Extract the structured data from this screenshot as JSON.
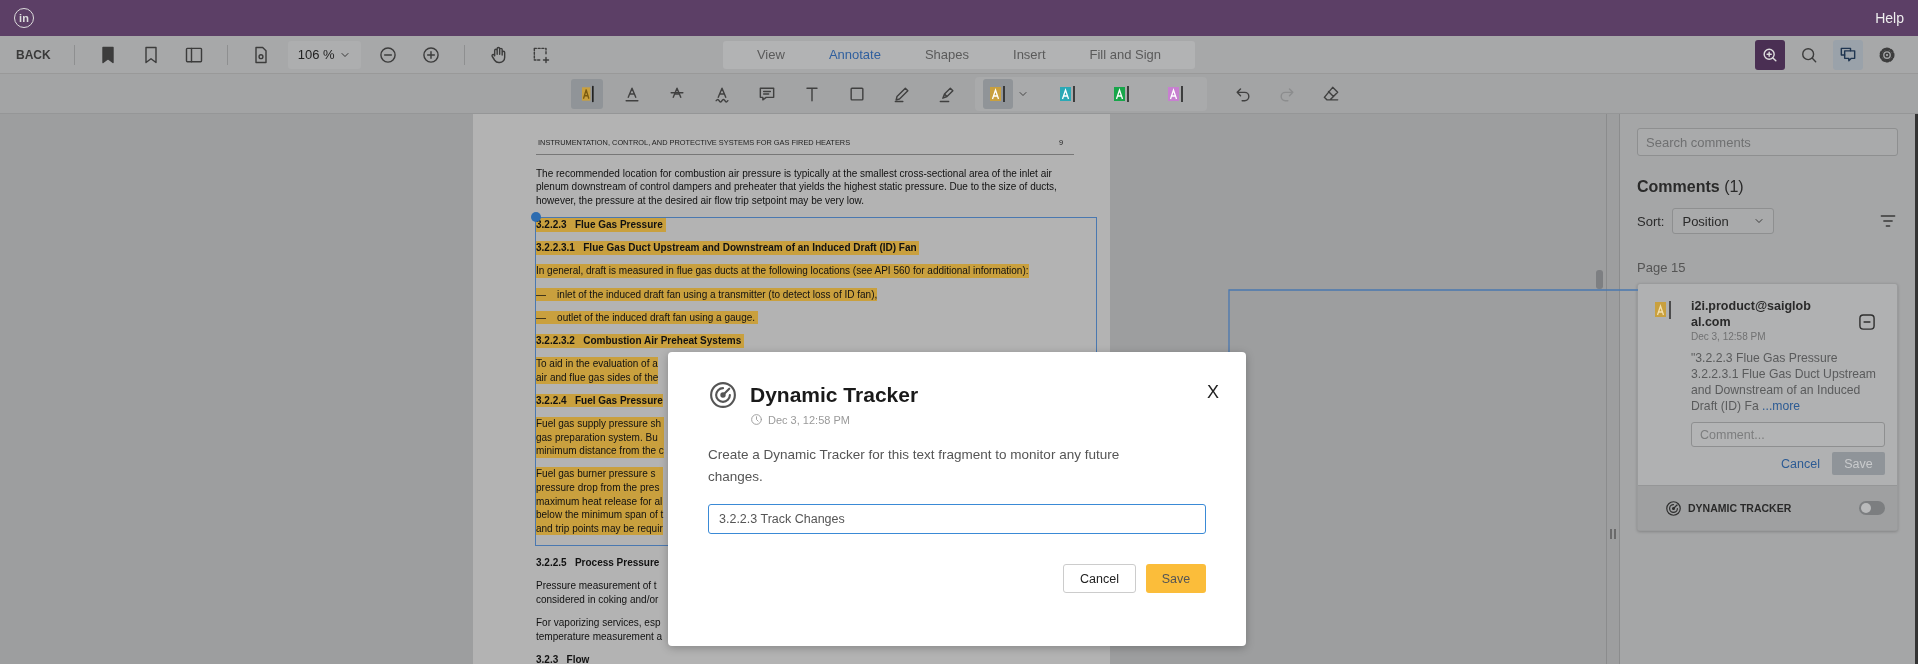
{
  "app_bar": {
    "logo_text": "in",
    "help": "Help"
  },
  "toolbar": {
    "back": "BACK",
    "zoom": "106 %",
    "mode_tabs": [
      {
        "label": "View",
        "selected": false
      },
      {
        "label": "Annotate",
        "selected": true
      },
      {
        "label": "Shapes",
        "selected": false
      },
      {
        "label": "Insert",
        "selected": false
      },
      {
        "label": "Fill and Sign",
        "selected": false
      }
    ],
    "right_tools": [
      {
        "selected": false
      },
      {
        "selected": false
      },
      {
        "selected": true
      },
      {
        "selected": false
      }
    ]
  },
  "annotation_tools": [
    {
      "selected": true
    },
    {
      "selected": false
    },
    {
      "selected": false
    },
    {
      "selected": false
    },
    {
      "selected": false
    },
    {
      "selected": false
    },
    {
      "selected": false
    },
    {
      "selected": false
    },
    {
      "selected": false
    }
  ],
  "color_tools": [
    {
      "color": "#c9a03e",
      "selected": true
    },
    {
      "color": "#2aa9b6",
      "selected": false
    },
    {
      "color": "#17a64a",
      "selected": false
    },
    {
      "color": "#c77fd0",
      "selected": false
    }
  ],
  "history_tools": [
    {
      "disabled": false
    },
    {
      "disabled": true
    }
  ],
  "document": {
    "running_header": "INSTRUMENTATION, CONTROL, AND PROTECTIVE SYSTEMS FOR GAS FIRED HEATERS",
    "page_number": "9",
    "intro": {
      "kind": "text",
      "highlighted": false,
      "lines": [
        "The recommended location for combustion air pressure is typically at the smallest cross-sectional area of the inlet air",
        "plenum downstream of control dampers and preheater that yields the highest static pressure. Due to the size of ducts,",
        "however, the pressure at the desired air flow trip setpoint may be very low."
      ]
    },
    "selection": [
      {
        "kind": "heading",
        "highlighted": true,
        "lines": [
          "3.2.2.3   Flue Gas Pressure "
        ]
      },
      {
        "kind": "heading",
        "highlighted": true,
        "lines": [
          "3.2.2.3.1   Flue Gas Duct Upstream and Downstream of an Induced Draft (ID) Fan "
        ]
      },
      {
        "kind": "text",
        "highlighted": true,
        "lines": [
          "In general, draft is measured in flue gas ducts at the following locations (see API 560 for additional information):"
        ]
      },
      {
        "kind": "text",
        "highlighted": true,
        "lines": [
          "—    inlet of the induced draft fan using a transmitter (to detect loss of ID fan),"
        ]
      },
      {
        "kind": "text",
        "highlighted": true,
        "lines": [
          "—    outlet of the induced draft fan using a gauge. "
        ]
      },
      {
        "kind": "heading",
        "highlighted": true,
        "lines": [
          "3.2.2.3.2   Combustion Air Preheat Systems "
        ]
      },
      {
        "kind": "text",
        "highlighted": true,
        "lines": [
          "To aid in the evaluation of a",
          "air and flue gas sides of the"
        ]
      },
      {
        "kind": "heading",
        "highlighted": true,
        "lines": [
          "3.2.2.4   Fuel Gas Pressure"
        ]
      },
      {
        "kind": "text",
        "highlighted": true,
        "lines": [
          "Fuel gas supply pressure sh",
          "gas preparation system. Bu",
          "minimum distance from the c"
        ]
      },
      {
        "kind": "text",
        "highlighted": true,
        "lines": [
          "Fuel gas burner pressure s",
          "pressure drop from the pres",
          "maximum heat release for al",
          "below the minimum span of t",
          "and trip points may be requir"
        ]
      }
    ],
    "after": [
      {
        "kind": "heading",
        "highlighted": false,
        "lines": [
          "3.2.2.5   Process Pressure"
        ]
      },
      {
        "kind": "text",
        "highlighted": false,
        "lines": [
          "Pressure measurement of t",
          "considered in coking and/or"
        ]
      },
      {
        "kind": "text",
        "highlighted": false,
        "lines": [
          "For vaporizing services, esp",
          "temperature measurement a"
        ]
      },
      {
        "kind": "heading",
        "highlighted": false,
        "lines": [
          "3.2.3   Flow"
        ]
      }
    ]
  },
  "comments_panel": {
    "search_placeholder": "Search comments",
    "title": "Comments",
    "count": "(1)",
    "sort_label": "Sort:",
    "sort_value": "Position",
    "page_label": "Page 15",
    "comments": [
      {
        "author": "i2i.product@saiglobal.com",
        "date": "Dec 3, 12:58 PM",
        "quote": "\"3.2.2.3 Flue Gas Pressure 3.2.2.3.1 Flue Gas Duct Upstream and Downstream of an Induced Draft (ID) Fa",
        "more_link": "...more",
        "reply_placeholder": "Comment...",
        "cancel": "Cancel",
        "save": "Save",
        "save_disabled": true,
        "tracker_label": "DYNAMIC TRACKER",
        "tracker_on": false
      }
    ]
  },
  "dialog": {
    "title": "Dynamic Tracker",
    "date": "Dec 3, 12:58 PM",
    "message": "Create a Dynamic Tracker for this text fragment to monitor any future changes.",
    "name_value": "3.2.2.3 Track Changes",
    "close": "X",
    "cancel": "Cancel",
    "save": "Save"
  }
}
